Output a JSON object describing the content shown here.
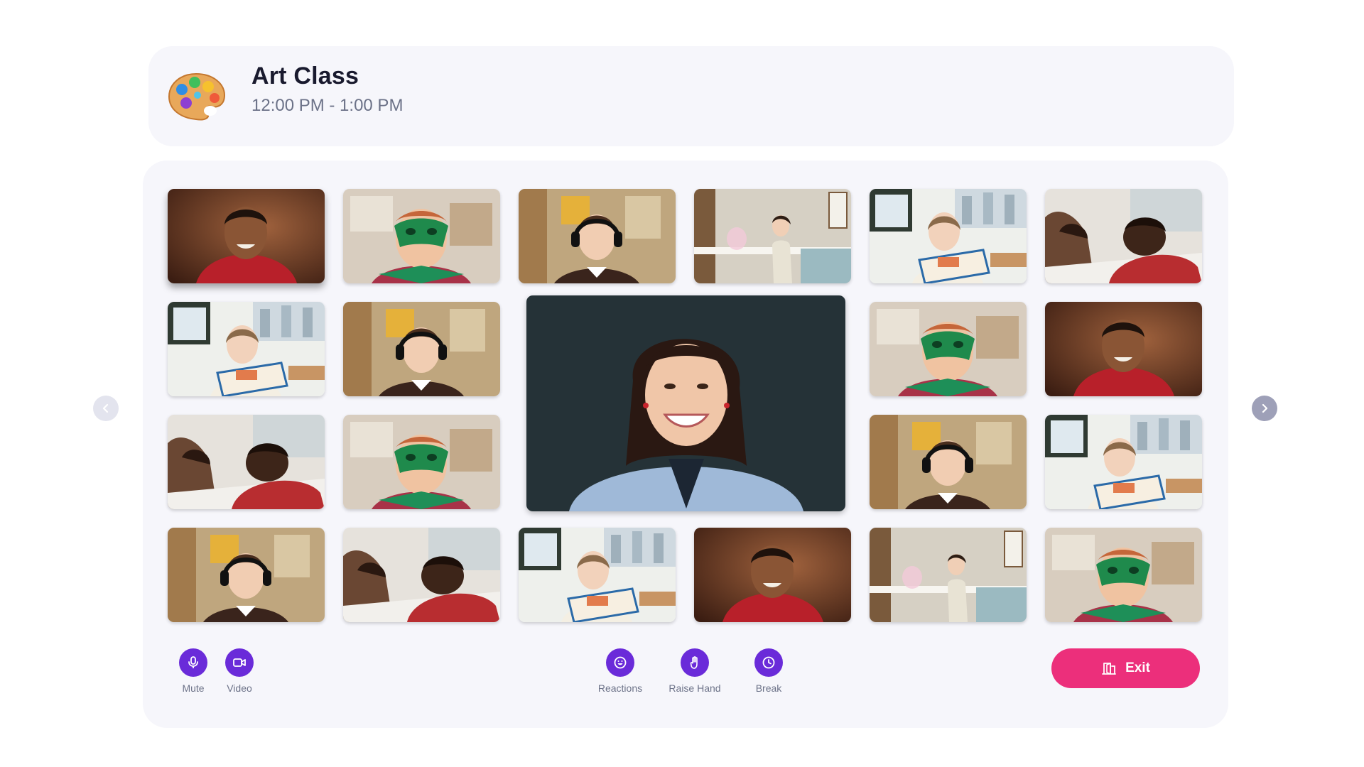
{
  "header": {
    "icon": "art-palette-icon",
    "title": "Art Class",
    "time": "12:00 PM - 1:00 PM"
  },
  "colors": {
    "accent": "#6a2bd9",
    "exit": "#ec2f7b",
    "panel": "#f6f6fb"
  },
  "participants": [
    {
      "photo": "boy-smiling-dark-background",
      "active": true
    },
    {
      "photo": "child-green-mask"
    },
    {
      "photo": "girl-headphones"
    },
    {
      "photo": "girl-crafting-table"
    },
    {
      "photo": "girl-reading-book"
    },
    {
      "photo": "boys-drawing"
    },
    {
      "photo": "girl-reading-book"
    },
    {
      "photo": "girl-headphones"
    },
    {
      "photo": "child-green-mask"
    },
    {
      "photo": "boy-smiling-dark-background"
    },
    {
      "photo": "boys-drawing"
    },
    {
      "photo": "child-green-mask"
    },
    {
      "photo": "girl-headphones"
    },
    {
      "photo": "girl-reading-book"
    },
    {
      "photo": "girl-headphones"
    },
    {
      "photo": "boys-drawing"
    },
    {
      "photo": "girl-reading-book"
    },
    {
      "photo": "boy-smiling-dark-background"
    },
    {
      "photo": "girl-crafting-table"
    },
    {
      "photo": "child-green-mask"
    }
  ],
  "featured": {
    "photo": "teacher-smiling"
  },
  "controls": {
    "mute": {
      "label": "Mute",
      "icon": "microphone-icon"
    },
    "video": {
      "label": "Video",
      "icon": "video-camera-icon"
    },
    "reactions": {
      "label": "Reactions",
      "icon": "smiley-icon"
    },
    "raise_hand": {
      "label": "Raise Hand",
      "icon": "hand-icon"
    },
    "break": {
      "label": "Break",
      "icon": "clock-icon"
    },
    "exit": {
      "label": "Exit",
      "icon": "door-exit-icon"
    }
  },
  "navigation": {
    "prev_icon": "chevron-left-icon",
    "next_icon": "chevron-right-icon"
  }
}
